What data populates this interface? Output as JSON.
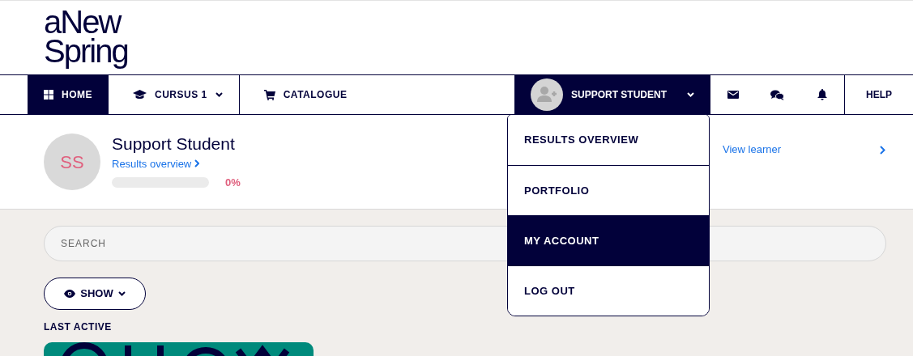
{
  "logo": {
    "line_1": "aNew",
    "line_2": "Spring"
  },
  "nav": [
    {
      "kind": "home",
      "label": "HOME",
      "selected": true,
      "caret": false
    },
    {
      "kind": "course",
      "label": "CURSUS 1",
      "selected": false,
      "caret": true
    },
    {
      "kind": "cart",
      "label": "CATALOGUE",
      "selected": false,
      "caret": false
    }
  ],
  "user_menu": {
    "label": "SUPPORT STUDENT",
    "expanded": true,
    "items": [
      {
        "label": "RESULTS OVERVIEW",
        "selected": false
      },
      {
        "label": "PORTFOLIO",
        "selected": false
      },
      {
        "label": "MY ACCOUNT",
        "selected": true
      },
      {
        "label": "LOG OUT",
        "selected": false
      }
    ]
  },
  "icon_buttons": [
    {
      "kind": "mail"
    },
    {
      "kind": "chat"
    },
    {
      "kind": "bell"
    }
  ],
  "help": "HELP",
  "profile": {
    "initials": "SS",
    "name": "Support Student",
    "link": "Results overview",
    "level": 0,
    "percent": "0%",
    "view_link": "View learner"
  },
  "search": {
    "placeholder": "SEARCH"
  },
  "show_button": "SHOW",
  "last_active": {
    "heading": "LAST ACTIVE"
  }
}
